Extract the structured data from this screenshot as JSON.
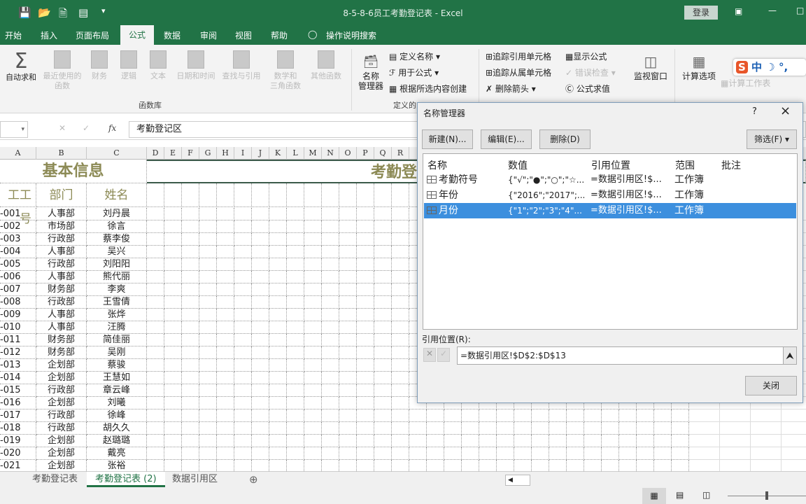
{
  "window": {
    "title": "8-5-8-6员工考勤登记表 - Excel",
    "login": "登录"
  },
  "tabs": [
    "开始",
    "插入",
    "页面布局",
    "公式",
    "数据",
    "审阅",
    "视图",
    "帮助",
    "操作说明搜索"
  ],
  "ribbon": {
    "function_library": {
      "label": "函数库",
      "items": [
        "自动求和",
        "最近使用的\n函数",
        "财务",
        "逻辑",
        "文本",
        "日期和时间",
        "查找与引用",
        "数学和\n三角函数",
        "其他函数"
      ]
    },
    "defined_names": {
      "label": "定义的",
      "name_manager": "名称\n管理器",
      "define_name": "定义名称",
      "use_in_formula": "用于公式",
      "create_from_selection": "根据所选内容创建"
    },
    "auditing": {
      "trace_precedents": "追踪引用单元格",
      "trace_dependents": "追踪从属单元格",
      "remove_arrows": "删除箭头",
      "show_formulas": "显示公式",
      "error_checking": "错误检查",
      "evaluate_formula": "公式求值"
    },
    "watch_window": "监视窗口",
    "calc_options": "计算选项",
    "calc_sheet": "计算工作表",
    "ime": "中"
  },
  "formula_bar": {
    "content": "考勤登记区",
    "fx": "fx"
  },
  "columns": [
    "A",
    "B",
    "C",
    "D",
    "E",
    "F",
    "G",
    "H",
    "I",
    "J",
    "K",
    "L",
    "M",
    "N",
    "O",
    "P",
    "Q",
    "R"
  ],
  "sheet": {
    "header1": "基本信息",
    "header1b": "考勤登",
    "col_headers": [
      "工工号",
      "部门",
      "姓名"
    ],
    "rows": [
      [
        "-001",
        "人事部",
        "刘丹晨"
      ],
      [
        "-002",
        "市场部",
        "徐言"
      ],
      [
        "-003",
        "行政部",
        "蔡李俊"
      ],
      [
        "-004",
        "人事部",
        "吴兴"
      ],
      [
        "-005",
        "行政部",
        "刘阳阳"
      ],
      [
        "-006",
        "人事部",
        "熊代丽"
      ],
      [
        "-007",
        "财务部",
        "李爽"
      ],
      [
        "-008",
        "行政部",
        "王雪倩"
      ],
      [
        "-009",
        "人事部",
        "张烨"
      ],
      [
        "-010",
        "人事部",
        "汪腾"
      ],
      [
        "-011",
        "财务部",
        "简佳丽"
      ],
      [
        "-012",
        "财务部",
        "吴刚"
      ],
      [
        "-013",
        "企划部",
        "蔡骏"
      ],
      [
        "-014",
        "企划部",
        "王慧如"
      ],
      [
        "-015",
        "行政部",
        "章云峰"
      ],
      [
        "-016",
        "企划部",
        "刘曦"
      ],
      [
        "-017",
        "行政部",
        "徐峰"
      ],
      [
        "-018",
        "行政部",
        "胡久久"
      ],
      [
        "-019",
        "企划部",
        "赵璐璐"
      ],
      [
        "-020",
        "企划部",
        "戴亮"
      ],
      [
        "-021",
        "企划部",
        "张裕"
      ]
    ]
  },
  "sheet_tabs": [
    "考勤登记表",
    "考勤登记表 (2)",
    "数据引用区"
  ],
  "active_sheet": 1,
  "dialog": {
    "title": "名称管理器",
    "help": "?",
    "close_x": "×",
    "new": "新建(N)...",
    "edit": "编辑(E)...",
    "delete": "删除(D)",
    "filter": "筛选(F) ▾",
    "headers": [
      "名称",
      "数值",
      "引用位置",
      "范围",
      "批注"
    ],
    "rows": [
      {
        "name": "考勤符号",
        "value": "{\"√\";\"●\";\"○\";\"☆...",
        "ref": "=数据引用区!$...",
        "scope": "工作簿",
        "comment": ""
      },
      {
        "name": "年份",
        "value": "{\"2016\";\"2017\";...",
        "ref": "=数据引用区!$...",
        "scope": "工作簿",
        "comment": ""
      },
      {
        "name": "月份",
        "value": "{\"1\";\"2\";\"3\";\"4\"...",
        "ref": "=数据引用区!$...",
        "scope": "工作簿",
        "comment": ""
      }
    ],
    "selected_row": 2,
    "refers_to_label": "引用位置(R):",
    "refers_to_value": "=数据引用区!$D$2:$D$13",
    "close": "关闭"
  },
  "colors": {
    "excel_green": "#217346",
    "header_gold": "#8c8a55",
    "selection": "#3c8fde"
  }
}
